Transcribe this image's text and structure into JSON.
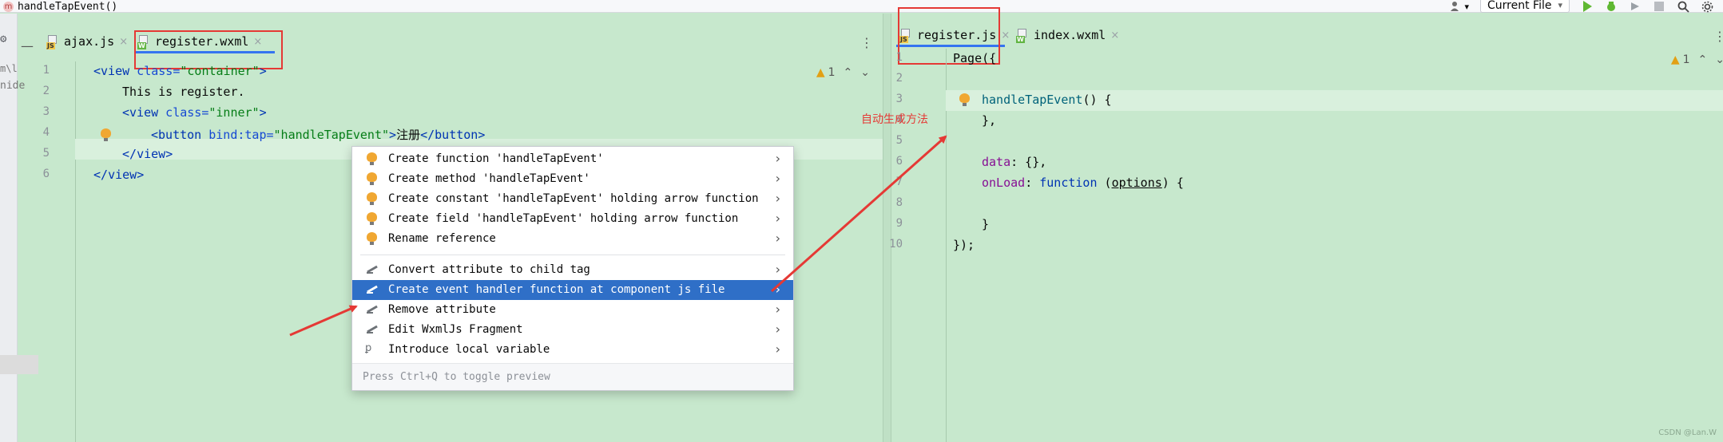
{
  "topbar": {
    "breadcrumb_badge": "m",
    "breadcrumb": "handleTapEvent()",
    "run_config": "Current File",
    "run_config_caret": "▾",
    "user_caret": "▾"
  },
  "left_gutter": {
    "fragment": "nide",
    "fragment2": "m\\l"
  },
  "left_pane": {
    "tabs": [
      {
        "name": "ajax.js",
        "icon_label": "JS",
        "close": "×"
      },
      {
        "name": "register.wxml",
        "icon_label": "W",
        "close": "×"
      }
    ],
    "inspection": {
      "count": "1",
      "up": "⌃",
      "down": "⌄",
      "icon": "▲"
    },
    "lines": [
      "1",
      "2",
      "3",
      "4",
      "5",
      "6"
    ]
  },
  "right_pane": {
    "tabs": [
      {
        "name": "register.js",
        "icon_label": "JS",
        "close": "×"
      },
      {
        "name": "index.wxml",
        "icon_label": "W",
        "close": "×"
      }
    ],
    "inspection": {
      "count": "1",
      "up": "⌃",
      "down": "⌄",
      "icon": "▲"
    },
    "lines": [
      "1",
      "2",
      "3",
      "4",
      "5",
      "6",
      "7",
      "8",
      "9",
      "10"
    ]
  },
  "code_left": {
    "l1": {
      "open": "<",
      "tag": "view",
      "attr": " class=",
      "val": "\"container\"",
      "close": ">"
    },
    "l2": "This is register.",
    "l3": {
      "open": "<",
      "tag": "view",
      "attr": " class=",
      "val": "\"inner\"",
      "close": ">"
    },
    "l4": {
      "open": "<",
      "tag": "button",
      "attr": " bind:tap=",
      "val": "\"handleTapEvent\"",
      "mid": ">",
      "text": "注册",
      "endopen": "</",
      "endtag": "button",
      "endclose": ">"
    },
    "l5": {
      "open": "</",
      "tag": "view",
      "close": ">"
    },
    "l6": {
      "open": "</",
      "tag": "view",
      "close": ">"
    }
  },
  "code_right": {
    "l1": "Page({",
    "l3": {
      "fn": "handleTapEvent",
      "rest": "() {"
    },
    "l4": "},",
    "l6": {
      "key": "data",
      "rest": ": {},"
    },
    "l7": {
      "key": "onLoad",
      "sep": ": ",
      "kw": "function",
      "sp": " (",
      "param": "options",
      "end": ") {"
    },
    "l9": "}",
    "l10": "});"
  },
  "popup": {
    "items": [
      {
        "label": "Create function 'handleTapEvent'",
        "icon": "bulb-icon",
        "chev": "›"
      },
      {
        "label": "Create method 'handleTapEvent'",
        "icon": "bulb-icon",
        "chev": "›"
      },
      {
        "label": "Create constant 'handleTapEvent' holding arrow function",
        "icon": "bulb-icon",
        "chev": "›"
      },
      {
        "label": "Create field 'handleTapEvent' holding arrow function",
        "icon": "bulb-icon",
        "chev": "›"
      },
      {
        "label": "Rename reference",
        "icon": "bulb-icon",
        "chev": "›"
      },
      {
        "label": "Convert attribute to child tag",
        "icon": "pencil-icon",
        "chev": "›"
      },
      {
        "label": "Create event handler function at component js file",
        "icon": "pencil-icon",
        "chev": "›",
        "selected": true
      },
      {
        "label": "Remove attribute",
        "icon": "pencil-icon",
        "chev": "›"
      },
      {
        "label": "Edit WxmlJs Fragment",
        "icon": "pencil-icon",
        "chev": "›"
      },
      {
        "label": "Introduce local variable",
        "icon": "variable-icon",
        "chev": "›"
      }
    ],
    "footer": "Press Ctrl+Q to toggle preview"
  },
  "annotation": "自动生成方法",
  "watermark": "CSDN @Lan.W",
  "colors": {
    "selection": "#2f6fc7",
    "annotation_red": "#e53935",
    "editor_bg": "#c7e8cd"
  }
}
